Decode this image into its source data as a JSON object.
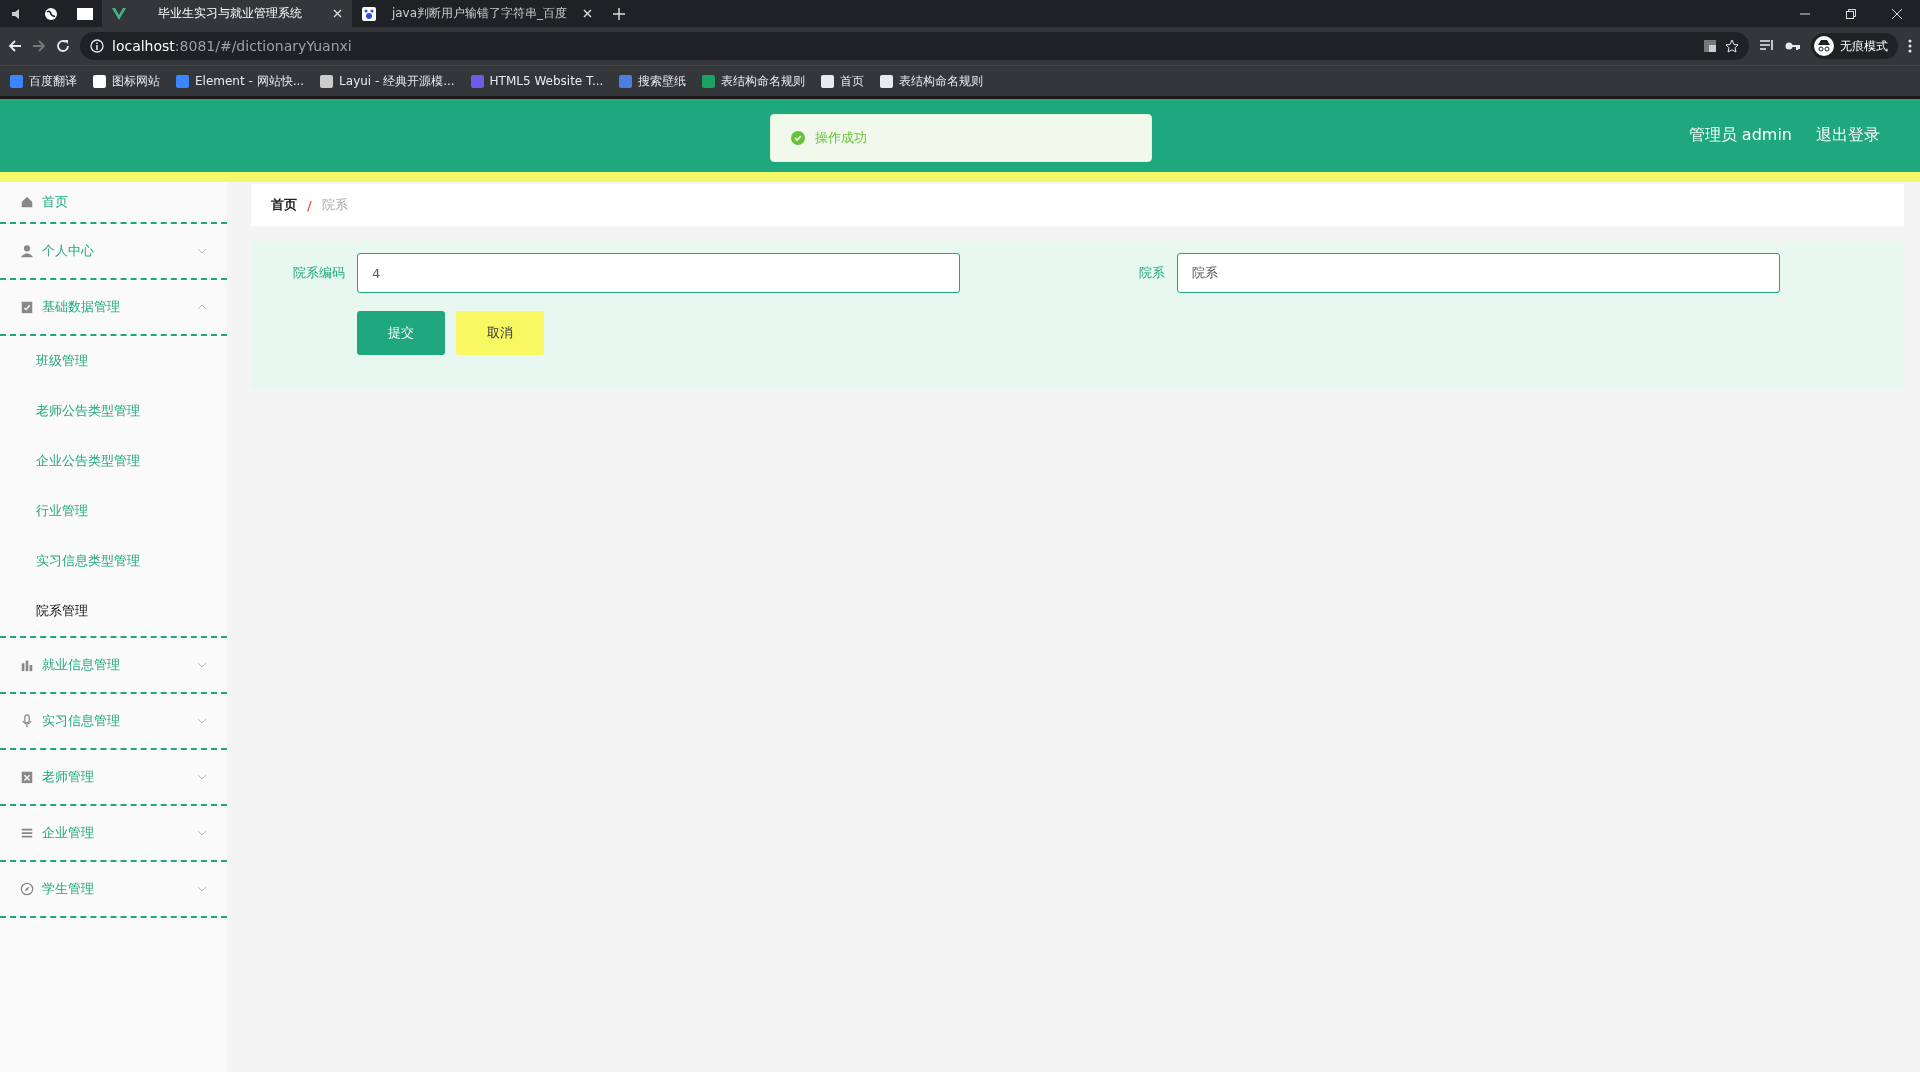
{
  "browser": {
    "tabs": [
      {
        "title": "毕业生实习与就业管理系统",
        "selected": true
      },
      {
        "title": "java判断用户输错了字符串_百度",
        "selected": false
      }
    ],
    "url_host": "localhost",
    "url_rest": ":8081/#/dictionaryYuanxi",
    "profile_label": "无痕模式",
    "bookmarks": [
      "百度翻译",
      "图标网站",
      "Element - 网站快...",
      "Layui - 经典开源模...",
      "HTML5 Website T...",
      "搜索壁纸",
      "表结构命名规则",
      "首页",
      "表结构命名规则"
    ]
  },
  "header": {
    "toast": "操作成功",
    "user": "管理员 admin",
    "logout": "退出登录"
  },
  "sidebar": {
    "items": [
      {
        "label": "首页",
        "kind": "link"
      },
      {
        "label": "个人中心",
        "kind": "menu",
        "expanded": false
      },
      {
        "label": "基础数据管理",
        "kind": "menu",
        "expanded": true,
        "children": [
          {
            "label": "班级管理",
            "selected": false
          },
          {
            "label": "老师公告类型管理",
            "selected": false
          },
          {
            "label": "企业公告类型管理",
            "selected": false
          },
          {
            "label": "行业管理",
            "selected": false
          },
          {
            "label": "实习信息类型管理",
            "selected": false
          },
          {
            "label": "院系管理",
            "selected": true
          }
        ]
      },
      {
        "label": "就业信息管理",
        "kind": "menu",
        "expanded": false
      },
      {
        "label": "实习信息管理",
        "kind": "menu",
        "expanded": false
      },
      {
        "label": "老师管理",
        "kind": "menu",
        "expanded": false
      },
      {
        "label": "企业管理",
        "kind": "menu",
        "expanded": false
      },
      {
        "label": "学生管理",
        "kind": "menu",
        "expanded": false
      }
    ]
  },
  "breadcrumb": {
    "items": [
      "首页",
      "院系"
    ],
    "separator": "/"
  },
  "form": {
    "fields": [
      {
        "label": "院系编码",
        "value": "4"
      },
      {
        "label": "院系",
        "value": "院系"
      }
    ],
    "buttons": [
      {
        "label": "提交",
        "kind": "primary"
      },
      {
        "label": "取消",
        "kind": "cancel"
      }
    ]
  }
}
